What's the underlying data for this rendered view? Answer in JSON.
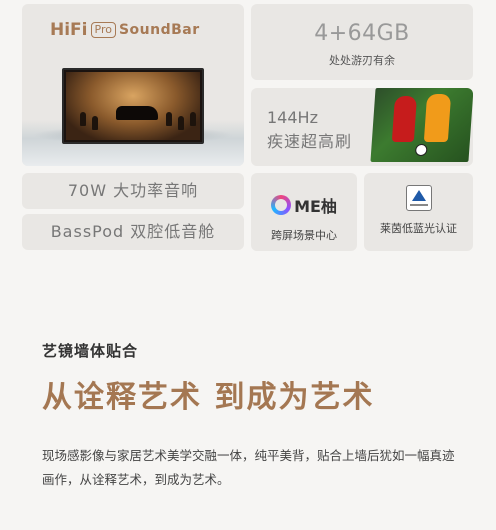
{
  "hero": {
    "brand": "HiFi",
    "badge": "Pro",
    "product": "SoundBar",
    "image_icon": "orchestra-tv-image"
  },
  "storage": {
    "main": "4+64GB",
    "sub": "处处游刃有余"
  },
  "refresh": {
    "main": "144Hz",
    "sub": "疾速超高刷",
    "image_icon": "soccer-players-image"
  },
  "features": {
    "power": "70W 大功率音响",
    "basspod": "BassPod 双腔低音舱"
  },
  "ome": {
    "logo_text": "ME柚",
    "label": "跨屏场景中心",
    "icon": "ome-logo-icon"
  },
  "tuv": {
    "label": "莱茵低蓝光认证",
    "icon": "tuv-certification-icon"
  },
  "section": {
    "label": "艺镜墙体贴合",
    "headline": "从诠释艺术 到成为艺术",
    "body": "现场感影像与家居艺术美学交融一体，纯平美背，贴合上墙后犹如一幅真迹画作，从诠释艺术，到成为艺术。"
  },
  "colors": {
    "accent": "#a47752",
    "card_bg": "#e9e7e4",
    "page_bg": "#f6f5f3"
  }
}
